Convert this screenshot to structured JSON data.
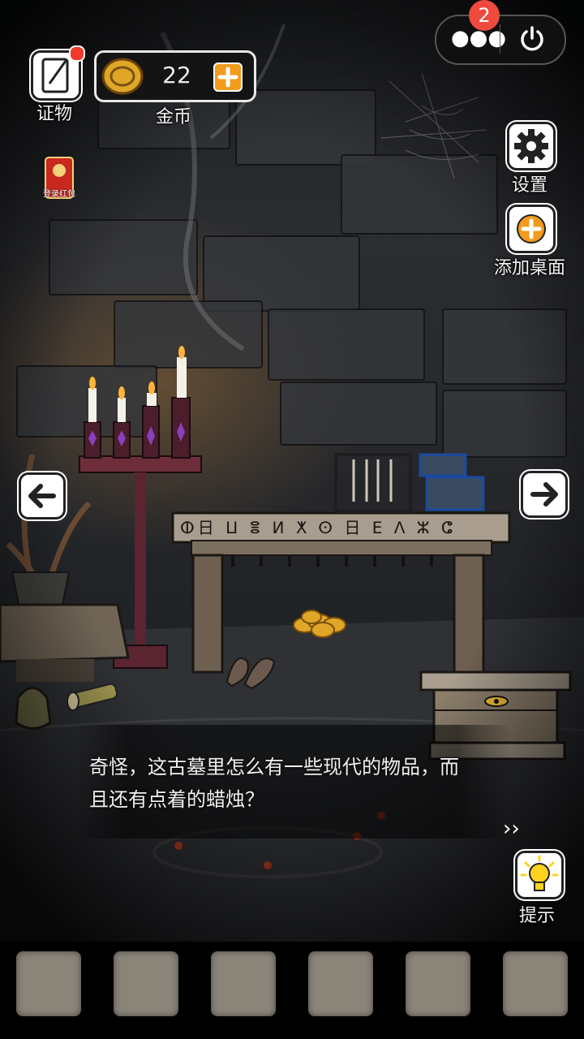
{
  "top_bar": {
    "evidence_label": "证物",
    "coins_value": "22",
    "coins_label": "金币",
    "notification_count": "2",
    "login_redpacket_label": "登录红包"
  },
  "side_menu": {
    "settings_label": "设置",
    "add_desktop_label": "添加桌面"
  },
  "scene": {
    "glyph_strip": "ⵀ日 ⵡ ⴻ ⵍ ⵅ ⵙ 日 ⴹ ⴷ ⵣ ⵛ"
  },
  "dialog": {
    "text": "奇怪，这古墓里怎么有一些现代的物品，而且还有点着的蜡烛？",
    "next_symbol": "››"
  },
  "hint": {
    "label": "提示"
  },
  "inventory": {
    "slot_count": 6
  },
  "colors": {
    "badge": "#f04a3e",
    "coin_gold": "#e0a628",
    "plus_orange": "#f29b1d",
    "hint_yellow": "#ffd21f",
    "slot": "#8a8479"
  }
}
